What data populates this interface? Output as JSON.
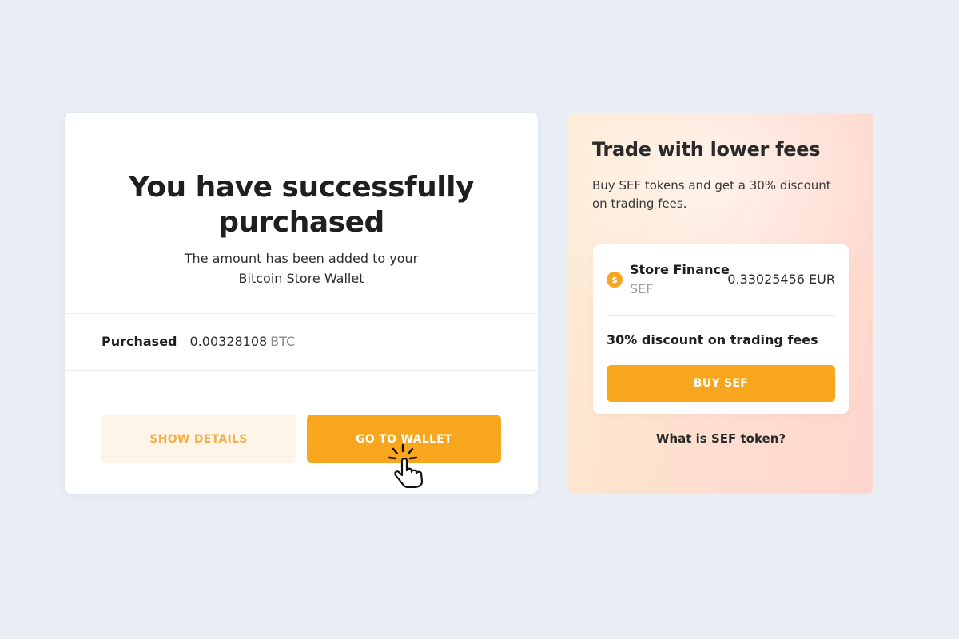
{
  "success": {
    "title_line1": "You have successfully",
    "title_line2": "purchased",
    "subtitle_line1": "The amount has been added to your",
    "subtitle_line2": "Bitcoin Store Wallet",
    "purchased_label": "Purchased",
    "purchased_amount": "0.00328108",
    "purchased_unit": "BTC",
    "show_details_label": "SHOW DETAILS",
    "go_to_wallet_label": "GO TO WALLET"
  },
  "promo": {
    "title": "Trade with lower fees",
    "description": "Buy SEF tokens and get a 30% discount on trading fees.",
    "token": {
      "icon": "dollar-coin-icon",
      "icon_glyph": "$",
      "name": "Store Finance",
      "symbol": "SEF",
      "price": "0.33025456 EUR"
    },
    "discount_text": "30% discount on trading fees",
    "buy_label": "BUY SEF",
    "link_label": "What is SEF token?"
  },
  "colors": {
    "accent": "#f7a61e",
    "accent_light": "#fef5e8",
    "background": "#e9eef5"
  },
  "cursor_icon": "hand-pointer-click-icon"
}
